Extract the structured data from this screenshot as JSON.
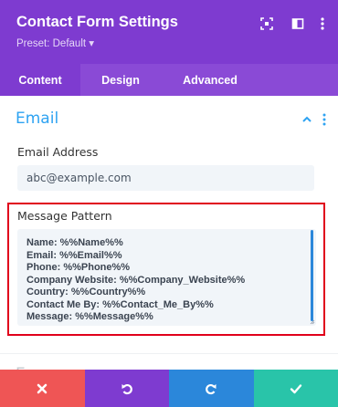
{
  "header": {
    "title": "Contact Form Settings",
    "preset": "Preset: Default ▾",
    "background": "#7e3bd0"
  },
  "tabs": [
    {
      "label": "Content",
      "active": true
    },
    {
      "label": "Design",
      "active": false
    },
    {
      "label": "Advanced",
      "active": false
    }
  ],
  "section": {
    "title": "Email",
    "accent": "#2ea3f2"
  },
  "fields": {
    "email_address": {
      "label": "Email Address",
      "value": "abc@example.com"
    },
    "message_pattern": {
      "label": "Message Pattern",
      "lines": [
        "Name: %%Name%%",
        "Email: %%Email%%",
        "Phone: %%Phone%%",
        "Company Website: %%Company_Website%%",
        "Country: %%Country%%",
        "Contact Me By: %%Contact_Me_By%%",
        "Message: %%Message%%"
      ]
    }
  },
  "next_section_peek": "E",
  "footer": {
    "buttons": [
      {
        "name": "discard",
        "icon": "close-icon",
        "color": "#ef5555"
      },
      {
        "name": "undo",
        "icon": "undo-icon",
        "color": "#7e3bd0"
      },
      {
        "name": "redo",
        "icon": "redo-icon",
        "color": "#2b87da"
      },
      {
        "name": "save",
        "icon": "check-icon",
        "color": "#29c4a9"
      }
    ]
  },
  "highlight_color": "#e0001b"
}
